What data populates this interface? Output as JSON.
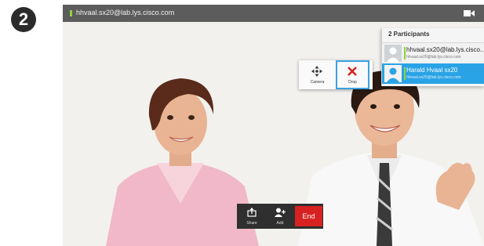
{
  "step_number": "2",
  "topbar": {
    "address": "hhvaal.sx20@lab.lys.cisco.com",
    "camera_icon": "camera-icon"
  },
  "participants": {
    "header": "2 Participants",
    "items": [
      {
        "name": "hhvaal.sx20@lab.lys.cisco....",
        "address": "hhvaal.sx20@lab.lys.cisco.com",
        "selected": false
      },
      {
        "name": "Harald Hvaal sx20",
        "address": "hhvaal.sx20@lab.lys.cisco.com",
        "selected": true
      }
    ]
  },
  "popup": {
    "camera_label": "Camera",
    "drop_label": "Drop"
  },
  "controls": {
    "share_label": "Share",
    "add_label": "Add",
    "end_label": "End"
  },
  "colors": {
    "accent": "#2aa3e6",
    "end": "#d72121",
    "status_green": "#8ed43a",
    "bar": "#5c5c5c"
  }
}
